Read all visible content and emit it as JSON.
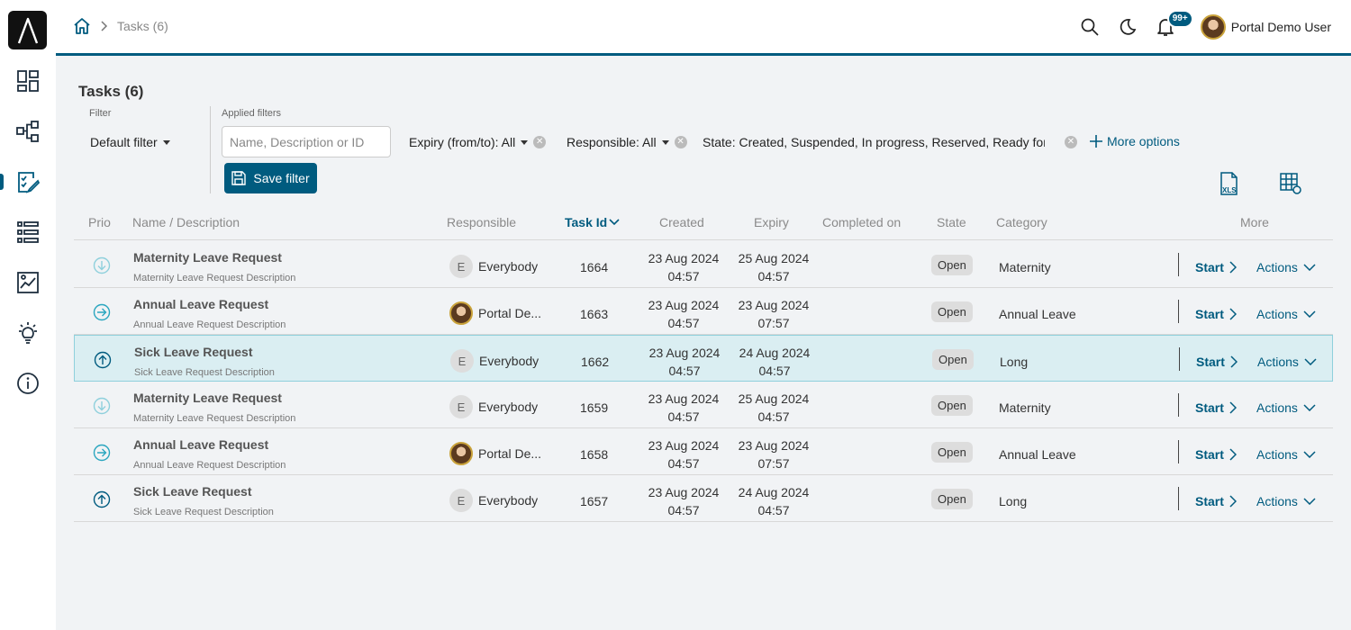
{
  "breadcrumb": {
    "current": "Tasks (6)"
  },
  "header": {
    "notifications_badge": "99+",
    "user_name": "Portal Demo User"
  },
  "page": {
    "title": "Tasks (6)"
  },
  "filters": {
    "filter_label": "Filter",
    "default_filter": "Default filter",
    "applied_label": "Applied filters",
    "search_placeholder": "Name, Description or ID",
    "expiry_chip": "Expiry (from/to): All",
    "responsible_chip": "Responsible: All",
    "state_chip": "State: Created, Suspended, In progress, Reserved, Ready for jo",
    "more_options": "More options",
    "save_filter": "Save filter"
  },
  "table": {
    "columns": {
      "prio": "Prio",
      "name": "Name / Description",
      "responsible": "Responsible",
      "task_id": "Task Id",
      "created": "Created",
      "expiry": "Expiry",
      "completed": "Completed on",
      "state": "State",
      "category": "Category",
      "more": "More"
    },
    "rows": [
      {
        "prio": "low",
        "name": "Maternity Leave Request",
        "desc": "Maternity Leave Request Description",
        "resp_type": "group",
        "resp_initial": "E",
        "responsible": "Everybody",
        "task_id": "1664",
        "created_date": "23 Aug 2024",
        "created_time": "04:57",
        "expiry_date": "25 Aug 2024",
        "expiry_time": "04:57",
        "completed": "",
        "state": "Open",
        "category": "Maternity",
        "start": "Start",
        "actions": "Actions"
      },
      {
        "prio": "normal",
        "name": "Annual Leave Request",
        "desc": "Annual Leave Request Description",
        "resp_type": "user",
        "resp_initial": "",
        "responsible": "Portal De...",
        "task_id": "1663",
        "created_date": "23 Aug 2024",
        "created_time": "04:57",
        "expiry_date": "23 Aug 2024",
        "expiry_time": "07:57",
        "completed": "",
        "state": "Open",
        "category": "Annual Leave",
        "start": "Start",
        "actions": "Actions"
      },
      {
        "prio": "high",
        "name": "Sick Leave Request",
        "desc": "Sick Leave Request Description",
        "resp_type": "group",
        "resp_initial": "E",
        "responsible": "Everybody",
        "task_id": "1662",
        "created_date": "23 Aug 2024",
        "created_time": "04:57",
        "expiry_date": "24 Aug 2024",
        "expiry_time": "04:57",
        "completed": "",
        "state": "Open",
        "category": "Long",
        "start": "Start",
        "actions": "Actions"
      },
      {
        "prio": "low",
        "name": "Maternity Leave Request",
        "desc": "Maternity Leave Request Description",
        "resp_type": "group",
        "resp_initial": "E",
        "responsible": "Everybody",
        "task_id": "1659",
        "created_date": "23 Aug 2024",
        "created_time": "04:57",
        "expiry_date": "25 Aug 2024",
        "expiry_time": "04:57",
        "completed": "",
        "state": "Open",
        "category": "Maternity",
        "start": "Start",
        "actions": "Actions"
      },
      {
        "prio": "normal",
        "name": "Annual Leave Request",
        "desc": "Annual Leave Request Description",
        "resp_type": "user",
        "resp_initial": "",
        "responsible": "Portal De...",
        "task_id": "1658",
        "created_date": "23 Aug 2024",
        "created_time": "04:57",
        "expiry_date": "23 Aug 2024",
        "expiry_time": "07:57",
        "completed": "",
        "state": "Open",
        "category": "Annual Leave",
        "start": "Start",
        "actions": "Actions"
      },
      {
        "prio": "high",
        "name": "Sick Leave Request",
        "desc": "Sick Leave Request Description",
        "resp_type": "group",
        "resp_initial": "E",
        "responsible": "Everybody",
        "task_id": "1657",
        "created_date": "23 Aug 2024",
        "created_time": "04:57",
        "expiry_date": "24 Aug 2024",
        "expiry_time": "04:57",
        "completed": "",
        "state": "Open",
        "category": "Long",
        "start": "Start",
        "actions": "Actions"
      }
    ],
    "selected_row": 2
  },
  "colors": {
    "accent": "#005b7f",
    "selected_row_bg": "#daeef2",
    "prio_light": "#8fd0dc"
  },
  "icons": [
    "home-icon",
    "search-icon",
    "moon-icon",
    "bell-icon",
    "dashboard-icon",
    "process-icon",
    "tasks-icon",
    "list-icon",
    "reports-icon",
    "ideas-icon",
    "info-icon",
    "xls-export-icon",
    "column-settings-icon"
  ]
}
